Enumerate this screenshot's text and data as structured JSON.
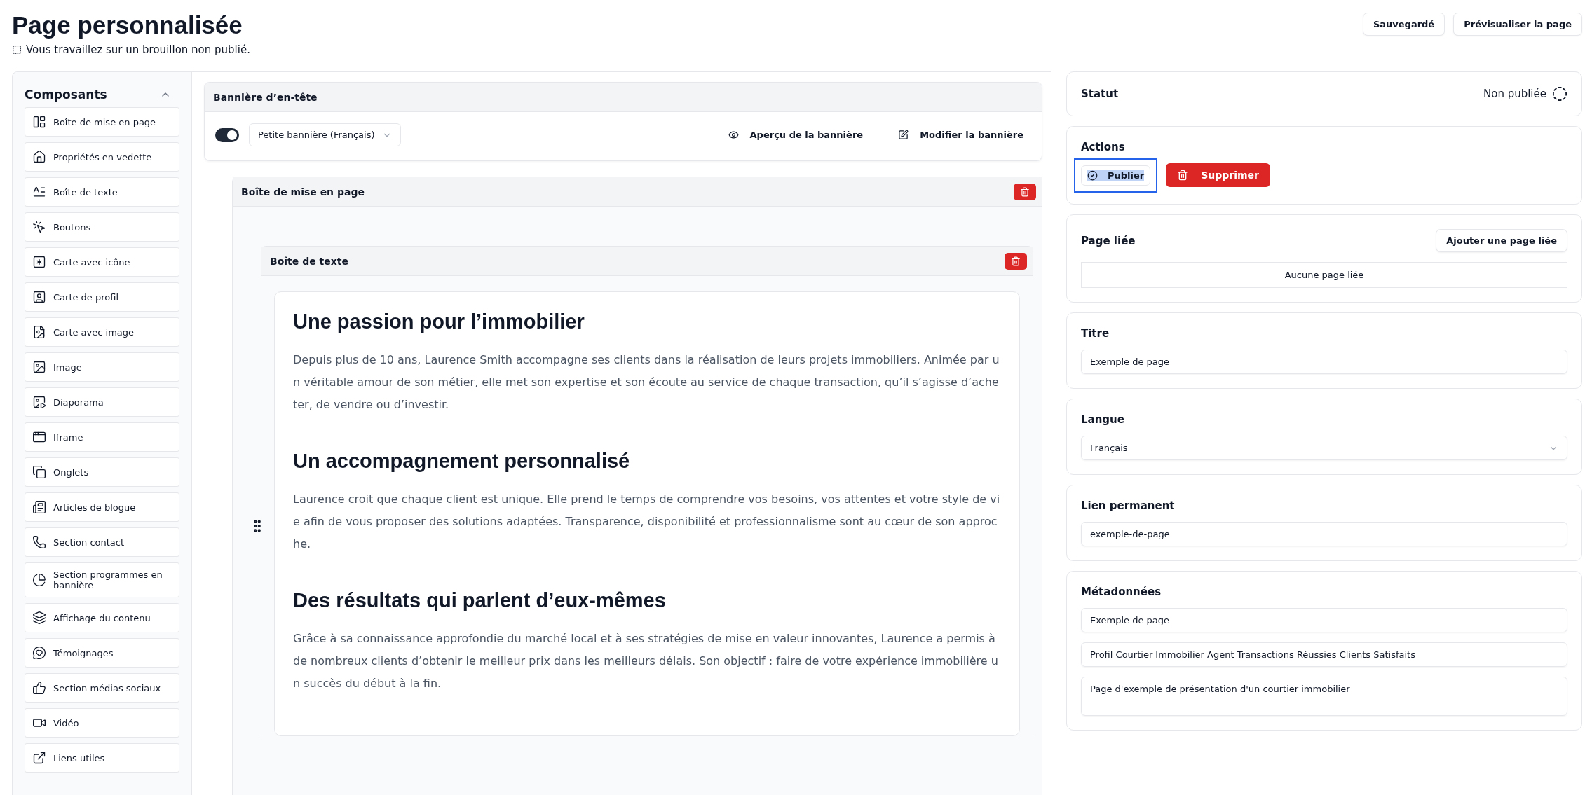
{
  "header": {
    "title": "Page personnalisée",
    "subtitle": "Vous travaillez sur un brouillon non publié.",
    "buttons": [
      "Sauvegardé",
      "Prévisualiser la page"
    ]
  },
  "components": {
    "title": "Composants",
    "expanded": true,
    "items": [
      "Boîte de mise en page",
      "Propriétés en vedette",
      "Boîte de texte",
      "Boutons",
      "Carte avec icône",
      "Carte de profil",
      "Carte avec image",
      "Image",
      "Diaporama",
      "Iframe",
      "Onglets",
      "Articles de blogue",
      "Section contact",
      "Section programmes en bannière",
      "Affichage du contenu",
      "Témoignages",
      "Section médias sociaux",
      "Vidéo",
      "Liens utiles"
    ]
  },
  "banner": {
    "title": "Bannière d’en-tête",
    "enabled": true,
    "select": "Petite bannière (Français)",
    "actions": [
      "Aperçu de la bannière",
      "Modifier la bannière"
    ]
  },
  "layout_box": {
    "title": "Boîte de mise en page",
    "text_box": {
      "title": "Boîte de texte",
      "sections": [
        {
          "heading": "Une passion pour l’immobilier",
          "body": "Depuis plus de 10 ans, Laurence Smith accompagne ses clients dans la réalisation de leurs projets immobiliers. Animée par un véritable amour de son métier, elle met son expertise et son écoute au service de chaque transaction, qu’il s’agisse d’acheter, de vendre ou d’investir."
        },
        {
          "heading": "Un accompagnement personnalisé",
          "body": "Laurence croit que chaque client est unique. Elle prend le temps de comprendre vos besoins, vos attentes et votre style de vie afin de vous proposer des solutions adaptées. Transparence, disponibilité et professionnalisme sont au cœur de son approche."
        },
        {
          "heading": "Des résultats qui parlent d’eux-mêmes",
          "body": "Grâce à sa connaissance approfondie du marché local et à ses stratégies de mise en valeur innovantes, Laurence a permis à de nombreux clients d’obtenir le meilleur prix dans les meilleurs délais. Son objectif : faire de votre expérience immobilière un succès du début à la fin."
        }
      ]
    }
  },
  "status": {
    "title": "Statut",
    "value": "Non publiée"
  },
  "actions": {
    "title": "Actions",
    "publish": {
      "label": "Publier",
      "focused": true
    },
    "delete": "Supprimer"
  },
  "linked_page": {
    "title": "Page liée",
    "button": "Ajouter une page liée",
    "empty": "Aucune page liée"
  },
  "title_field": {
    "title": "Titre",
    "value": "Exemple de page"
  },
  "language": {
    "title": "Langue",
    "value": "Français"
  },
  "permalink": {
    "title": "Lien permanent",
    "value": "exemple-de-page"
  },
  "metadata": {
    "title": "Métadonnées",
    "fields": [
      {
        "kind": "input",
        "value": "Exemple de page"
      },
      {
        "kind": "input",
        "value": "Profil Courtier Immobilier Agent Transactions Réussies Clients Satisfaits"
      },
      {
        "kind": "textarea",
        "value": "Page d'exemple de présentation d'un courtier immobilier"
      }
    ]
  }
}
